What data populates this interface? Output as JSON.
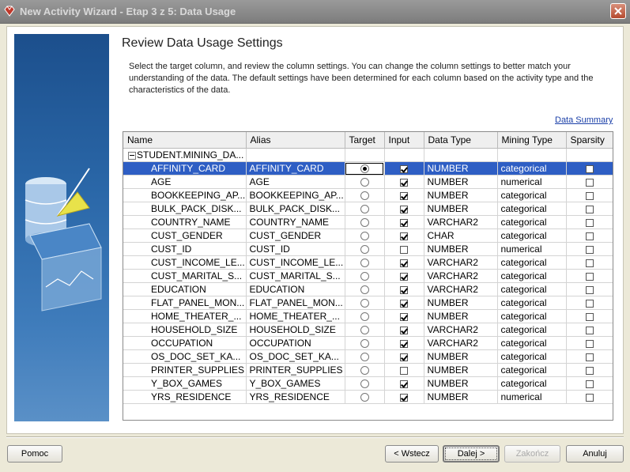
{
  "window": {
    "title": "New Activity Wizard - Etap 3 z 5: Data Usage"
  },
  "page": {
    "title": "Review Data Usage Settings",
    "instructions": "Select the target column, and review the column settings. You can change the column settings to better match your understanding of the data. The default settings have been determined for each column based on the activity type and the characteristics of the data.",
    "summary_link": "Data Summary"
  },
  "table": {
    "headers": [
      "Name",
      "Alias",
      "Target",
      "Input",
      "Data Type",
      "Mining Type",
      "Sparsity"
    ],
    "group": "STUDENT.MINING_DA...",
    "rows": [
      {
        "name": "AFFINITY_CARD",
        "alias": "AFFINITY_CARD",
        "target": true,
        "input": true,
        "data_type": "NUMBER",
        "mining_type": "categorical",
        "sparsity": false
      },
      {
        "name": "AGE",
        "alias": "AGE",
        "target": false,
        "input": true,
        "data_type": "NUMBER",
        "mining_type": "numerical",
        "sparsity": false
      },
      {
        "name": "BOOKKEEPING_AP...",
        "alias": "BOOKKEEPING_AP...",
        "target": false,
        "input": true,
        "data_type": "NUMBER",
        "mining_type": "categorical",
        "sparsity": false
      },
      {
        "name": "BULK_PACK_DISK...",
        "alias": "BULK_PACK_DISK...",
        "target": false,
        "input": true,
        "data_type": "NUMBER",
        "mining_type": "categorical",
        "sparsity": false
      },
      {
        "name": "COUNTRY_NAME",
        "alias": "COUNTRY_NAME",
        "target": false,
        "input": true,
        "data_type": "VARCHAR2",
        "mining_type": "categorical",
        "sparsity": false
      },
      {
        "name": "CUST_GENDER",
        "alias": "CUST_GENDER",
        "target": false,
        "input": true,
        "data_type": "CHAR",
        "mining_type": "categorical",
        "sparsity": false
      },
      {
        "name": "CUST_ID",
        "alias": "CUST_ID",
        "target": false,
        "input": false,
        "data_type": "NUMBER",
        "mining_type": "numerical",
        "sparsity": false
      },
      {
        "name": "CUST_INCOME_LE...",
        "alias": "CUST_INCOME_LE...",
        "target": false,
        "input": true,
        "data_type": "VARCHAR2",
        "mining_type": "categorical",
        "sparsity": false
      },
      {
        "name": "CUST_MARITAL_S...",
        "alias": "CUST_MARITAL_S...",
        "target": false,
        "input": true,
        "data_type": "VARCHAR2",
        "mining_type": "categorical",
        "sparsity": false
      },
      {
        "name": "EDUCATION",
        "alias": "EDUCATION",
        "target": false,
        "input": true,
        "data_type": "VARCHAR2",
        "mining_type": "categorical",
        "sparsity": false
      },
      {
        "name": "FLAT_PANEL_MON...",
        "alias": "FLAT_PANEL_MON...",
        "target": false,
        "input": true,
        "data_type": "NUMBER",
        "mining_type": "categorical",
        "sparsity": false
      },
      {
        "name": "HOME_THEATER_...",
        "alias": "HOME_THEATER_...",
        "target": false,
        "input": true,
        "data_type": "NUMBER",
        "mining_type": "categorical",
        "sparsity": false
      },
      {
        "name": "HOUSEHOLD_SIZE",
        "alias": "HOUSEHOLD_SIZE",
        "target": false,
        "input": true,
        "data_type": "VARCHAR2",
        "mining_type": "categorical",
        "sparsity": false
      },
      {
        "name": "OCCUPATION",
        "alias": "OCCUPATION",
        "target": false,
        "input": true,
        "data_type": "VARCHAR2",
        "mining_type": "categorical",
        "sparsity": false
      },
      {
        "name": "OS_DOC_SET_KA...",
        "alias": "OS_DOC_SET_KA...",
        "target": false,
        "input": true,
        "data_type": "NUMBER",
        "mining_type": "categorical",
        "sparsity": false
      },
      {
        "name": "PRINTER_SUPPLIES",
        "alias": "PRINTER_SUPPLIES",
        "target": false,
        "input": false,
        "data_type": "NUMBER",
        "mining_type": "categorical",
        "sparsity": false
      },
      {
        "name": "Y_BOX_GAMES",
        "alias": "Y_BOX_GAMES",
        "target": false,
        "input": true,
        "data_type": "NUMBER",
        "mining_type": "categorical",
        "sparsity": false
      },
      {
        "name": "YRS_RESIDENCE",
        "alias": "YRS_RESIDENCE",
        "target": false,
        "input": true,
        "data_type": "NUMBER",
        "mining_type": "numerical",
        "sparsity": false
      }
    ]
  },
  "buttons": {
    "help": "Pomoc",
    "back": "< Wstecz",
    "next": "Dalej >",
    "finish": "Zakończ",
    "cancel": "Anuluj"
  }
}
